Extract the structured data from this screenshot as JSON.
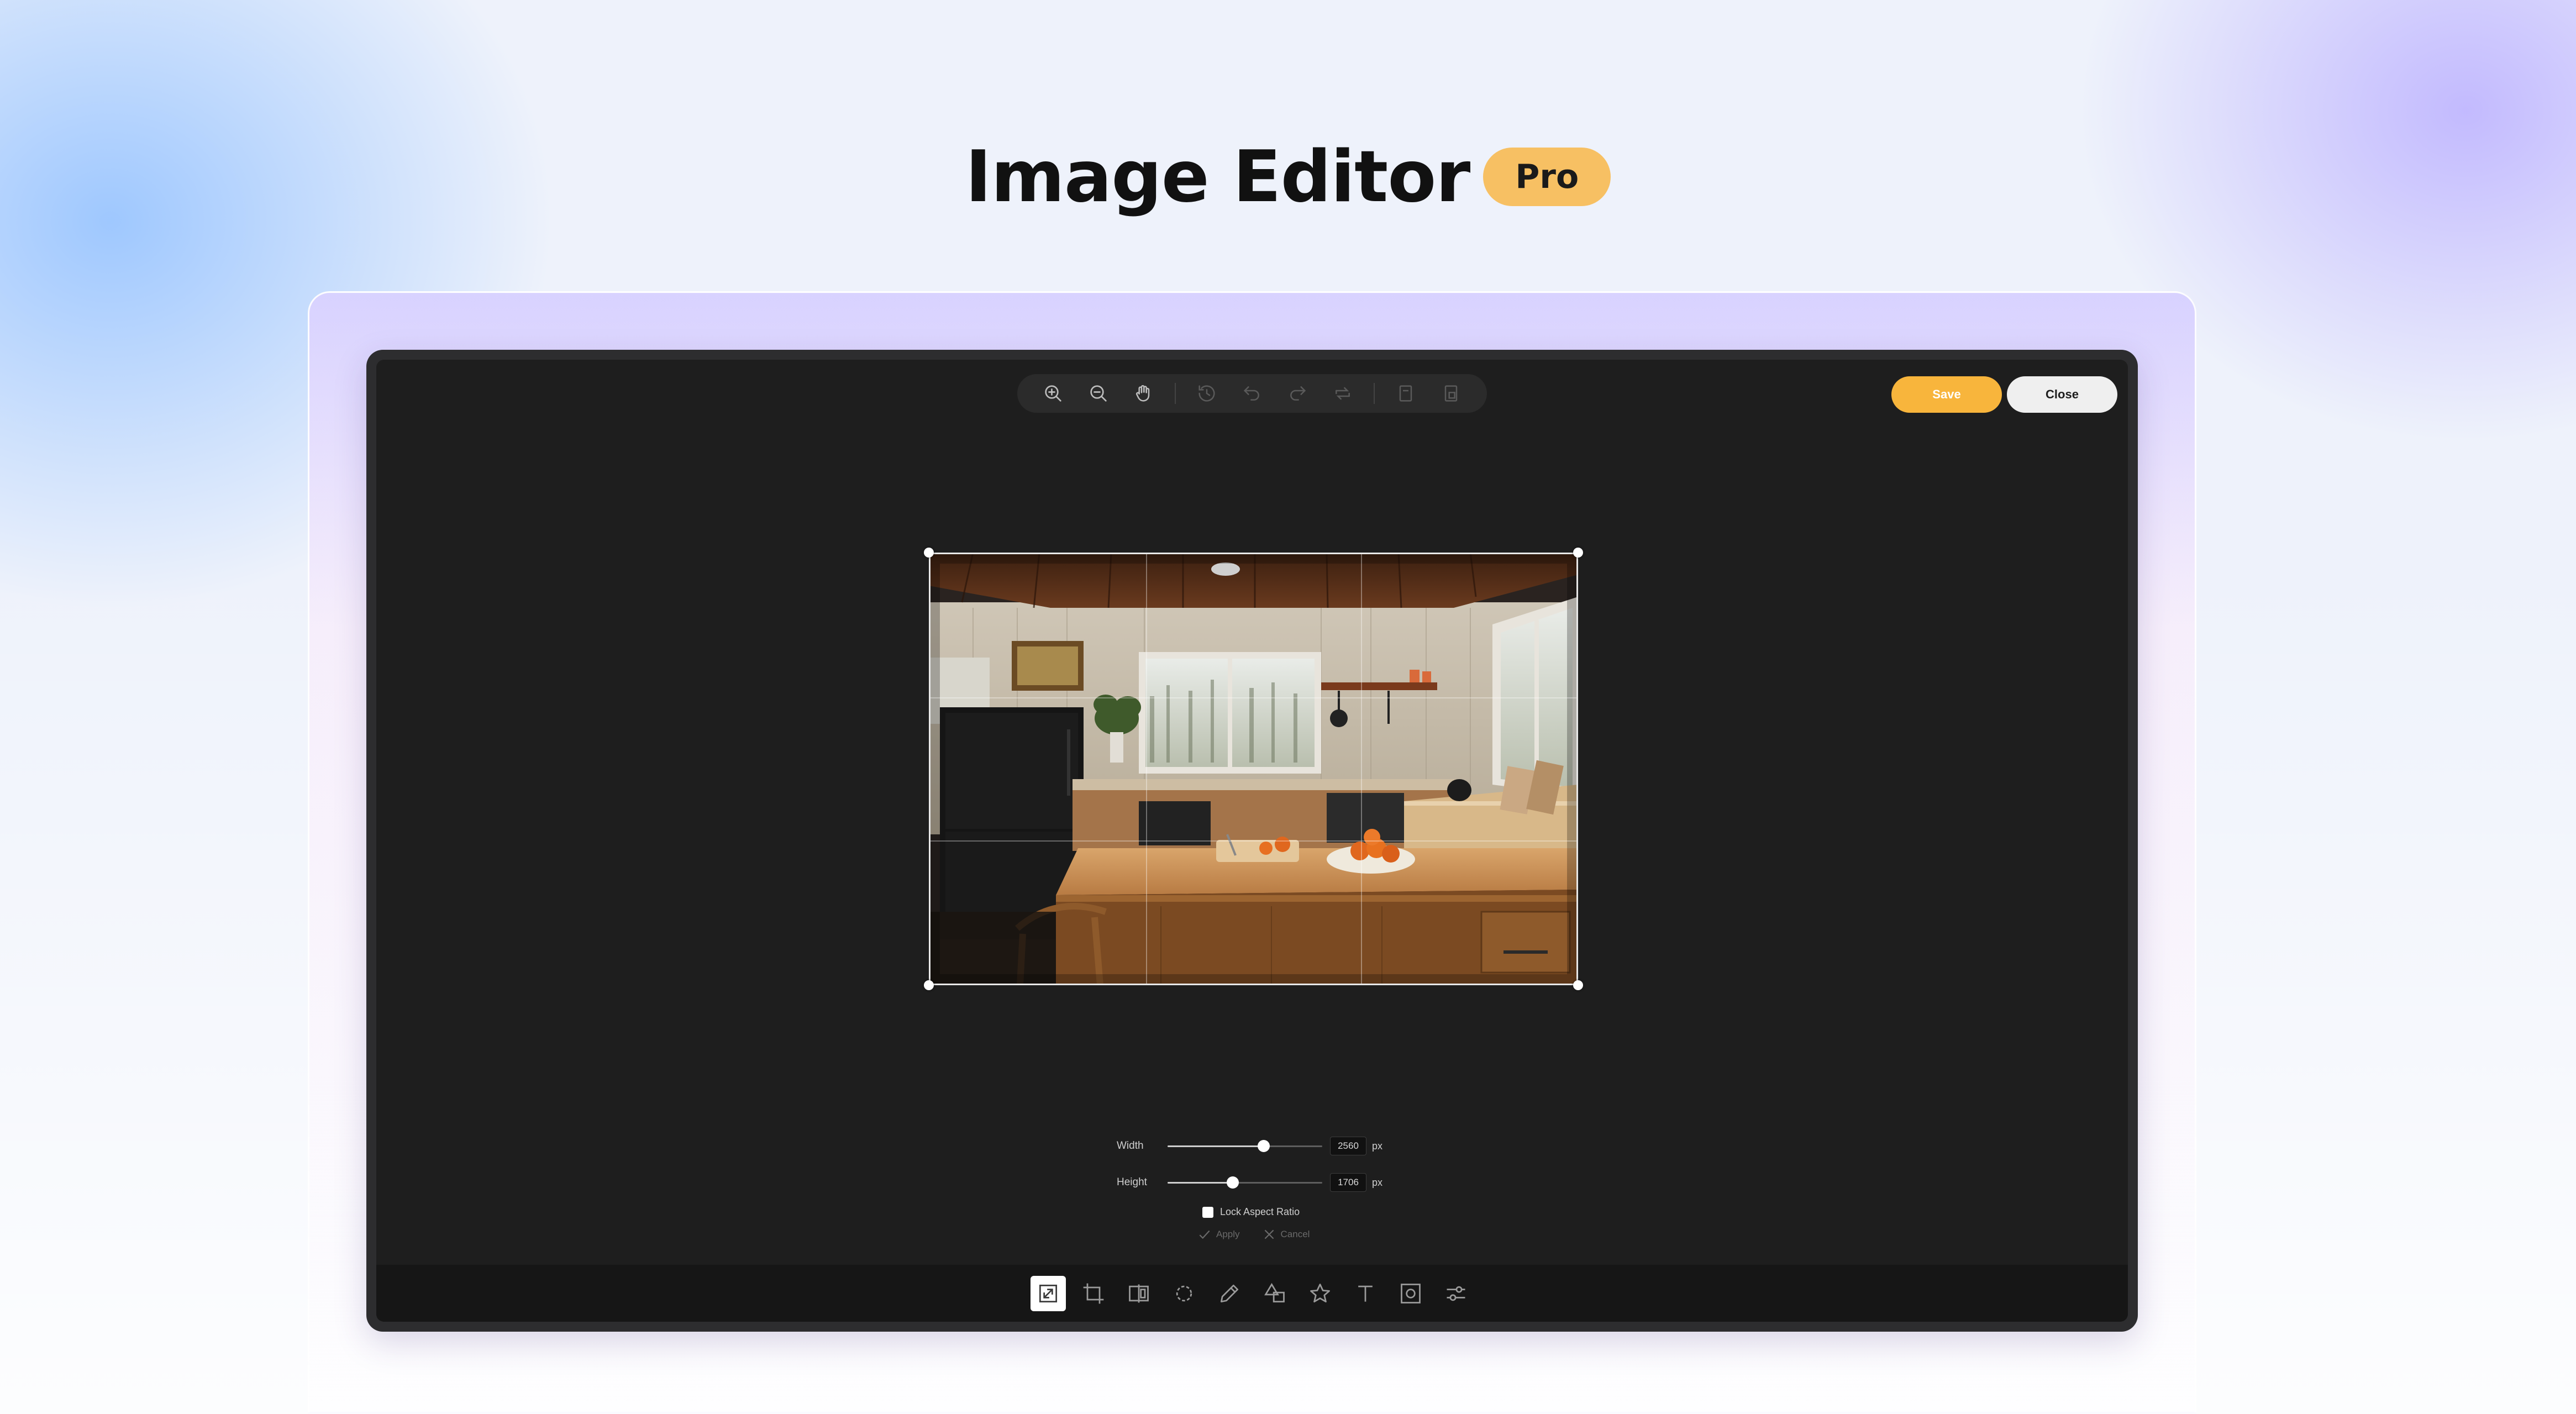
{
  "page": {
    "title": "Image Editor",
    "badge": "Pro"
  },
  "toolbar": {
    "save_label": "Save",
    "close_label": "Close",
    "buttons": [
      {
        "icon": "zoom-in-icon",
        "enabled": true
      },
      {
        "icon": "zoom-out-icon",
        "enabled": true
      },
      {
        "icon": "hand-pan-icon",
        "enabled": true
      },
      {
        "icon": "history-icon",
        "enabled": false
      },
      {
        "icon": "undo-icon",
        "enabled": false
      },
      {
        "icon": "redo-icon",
        "enabled": false
      },
      {
        "icon": "reset-icon",
        "enabled": false
      },
      {
        "icon": "copy-icon",
        "enabled": false
      },
      {
        "icon": "paste-icon",
        "enabled": false
      }
    ]
  },
  "resize": {
    "width_label": "Width",
    "height_label": "Height",
    "width_value": "2560",
    "height_value": "1706",
    "unit": "px",
    "width_slider_fraction": 0.62,
    "height_slider_fraction": 0.42,
    "lock_label": "Lock Aspect Ratio",
    "lock_checked": false,
    "apply_label": "Apply",
    "cancel_label": "Cancel"
  },
  "bottom_tools": [
    {
      "name": "resize-tool",
      "icon": "resize-icon",
      "active": true
    },
    {
      "name": "crop-tool",
      "icon": "crop-icon",
      "active": false
    },
    {
      "name": "flip-tool",
      "icon": "flip-icon",
      "active": false
    },
    {
      "name": "rotate-tool",
      "icon": "rotate-icon",
      "active": false
    },
    {
      "name": "draw-tool",
      "icon": "pencil-icon",
      "active": false
    },
    {
      "name": "shape-tool",
      "icon": "shapes-icon",
      "active": false
    },
    {
      "name": "sticker-tool",
      "icon": "star-icon",
      "active": false
    },
    {
      "name": "text-tool",
      "icon": "text-icon",
      "active": false
    },
    {
      "name": "mask-tool",
      "icon": "mask-icon",
      "active": false
    },
    {
      "name": "adjust-tool",
      "icon": "sliders-icon",
      "active": false
    }
  ],
  "colors": {
    "accent": "#f8b53c",
    "badge": "#f7c063",
    "editor_bg": "#1e1e1e"
  }
}
